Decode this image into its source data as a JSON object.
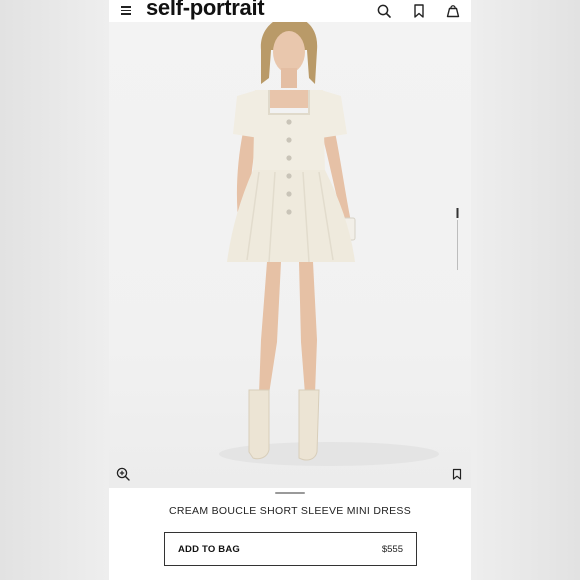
{
  "header": {
    "brand": "self-portrait",
    "menu_icon": "hamburger-menu-icon",
    "search_icon": "search-icon",
    "wishlist_icon": "bookmark-icon",
    "bag_icon": "shopping-bag-icon"
  },
  "hero": {
    "zoom_icon": "zoom-in-icon",
    "save_icon": "bookmark-icon",
    "image_count": 6,
    "current_image": 1
  },
  "product": {
    "title": "CREAM BOUCLE SHORT SLEEVE MINI DRESS",
    "add_to_bag_label": "ADD TO BAG",
    "price": "$555"
  },
  "colors": {
    "accent": "#111111",
    "background": "#f3f3f3",
    "dress": "#f1ede2"
  }
}
